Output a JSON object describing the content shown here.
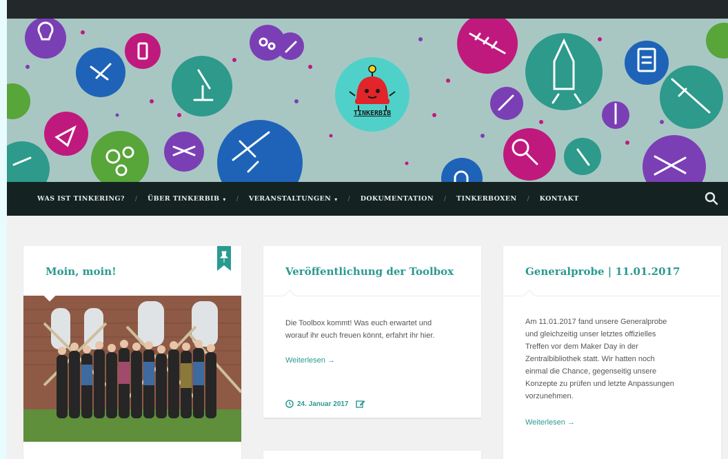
{
  "brand": {
    "logo_text": "TINKERBIB",
    "colors": {
      "teal": "#2a9a91",
      "nav_bg": "#142321",
      "header_bg": "#a8c7c3"
    }
  },
  "nav": {
    "items": [
      {
        "label": "WAS IST TINKERING?",
        "dropdown": false
      },
      {
        "label": "ÜBER TINKERBIB",
        "dropdown": true
      },
      {
        "label": "VERANSTALTUNGEN",
        "dropdown": true
      },
      {
        "label": "DOKUMENTATION",
        "dropdown": false
      },
      {
        "label": "TINKERBOXEN",
        "dropdown": false
      },
      {
        "label": "KONTAKT",
        "dropdown": false
      }
    ],
    "separator": "/",
    "caret": "▾",
    "search_icon": "search-icon"
  },
  "posts": [
    {
      "title": "Moin, moin!",
      "sticky_icon": "pin-icon",
      "image": "group-photo"
    },
    {
      "title": "Veröffentlichung der Toolbox",
      "excerpt_lines": [
        "Die Toolbox kommt! Was euch erwartet und",
        "worauf ihr euch freuen könnt, erfahrt ihr hier."
      ],
      "more": "Weiterlesen →",
      "date": "24. Januar 2017",
      "date_icon": "clock-icon",
      "edit_icon": "edit-icon"
    },
    {
      "title": "Generalprobe | 11.01.2017",
      "excerpt_lines": [
        "Am 11.01.2017 fand unsere Generalprobe",
        "und gleichzeitig unser letztes offizielles",
        "Treffen vor dem Maker Day in der",
        "Zentralbibliothek statt. Wir hatten noch",
        "einmal die Chance, gegenseitig unsere",
        "Konzepte zu prüfen und letzte Anpassungen",
        "vorzunehmen."
      ],
      "more": "Weiterlesen →"
    }
  ]
}
